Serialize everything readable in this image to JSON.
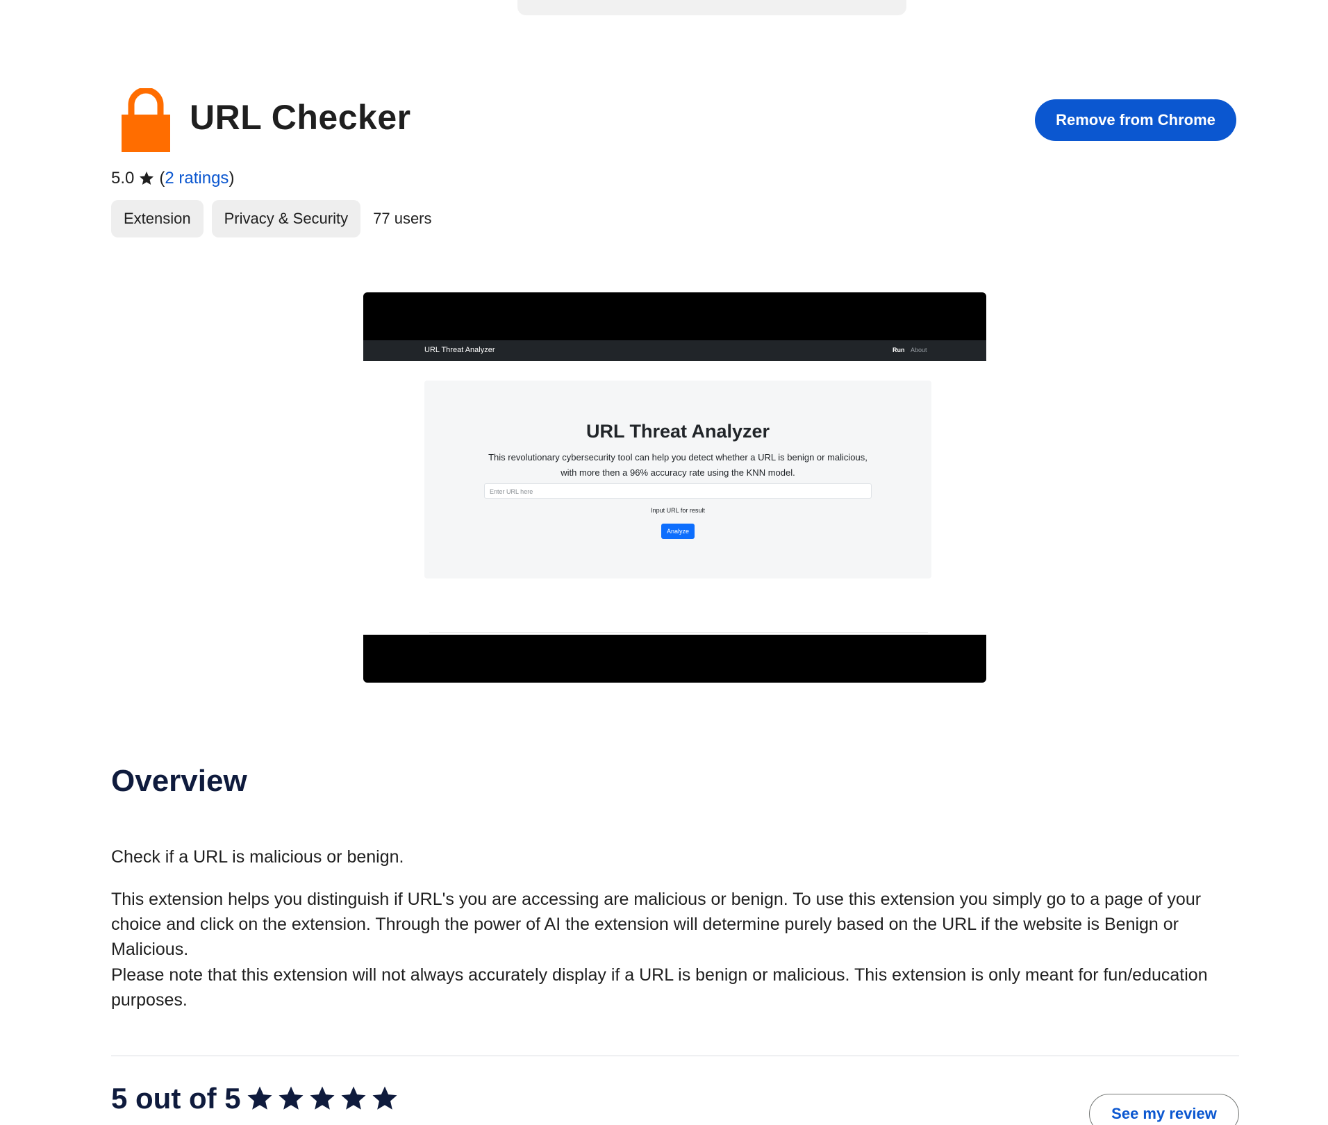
{
  "app": {
    "title": "URL Checker",
    "icon": "lock-icon",
    "icon_color": "#ff6d00",
    "action_label": "Remove from Chrome"
  },
  "rating": {
    "score": "5.0",
    "open_paren": "(",
    "ratings_label": "2 ratings",
    "close_paren": ")"
  },
  "chips": [
    {
      "label": "Extension"
    },
    {
      "label": "Privacy & Security"
    }
  ],
  "users_label": "77 users",
  "screenshot": {
    "nav_title": "URL Threat Analyzer",
    "nav_run": "Run",
    "nav_about": "About",
    "heading": "URL Threat Analyzer",
    "description_line1": "This revolutionary cybersecurity tool can help you detect whether a URL is benign or malicious,",
    "description_line2": "with more then a 96% accuracy rate using the KNN model.",
    "input_placeholder": "Enter URL here",
    "hint": "Input URL for result",
    "analyze_label": "Analyze"
  },
  "overview": {
    "title": "Overview",
    "summary": "Check if a URL is malicious or benign.",
    "paragraph1": "This extension helps you distinguish if URL's you are accessing are malicious or benign. To use this extension you simply go to a page of your choice and click on the extension. Through the power of AI the extension will determine purely based on the URL if the website is Benign or Malicious.",
    "paragraph2": "Please note that this extension will not always accurately display if a URL is benign or malicious. This extension is only meant for fun/education purposes."
  },
  "reviews": {
    "score_label": "5 out of 5",
    "stars": 5,
    "see_review_label": "See my review"
  },
  "colors": {
    "accent": "#0b57d0",
    "heading": "#0f1b3d",
    "icon_orange": "#ff6d00"
  }
}
